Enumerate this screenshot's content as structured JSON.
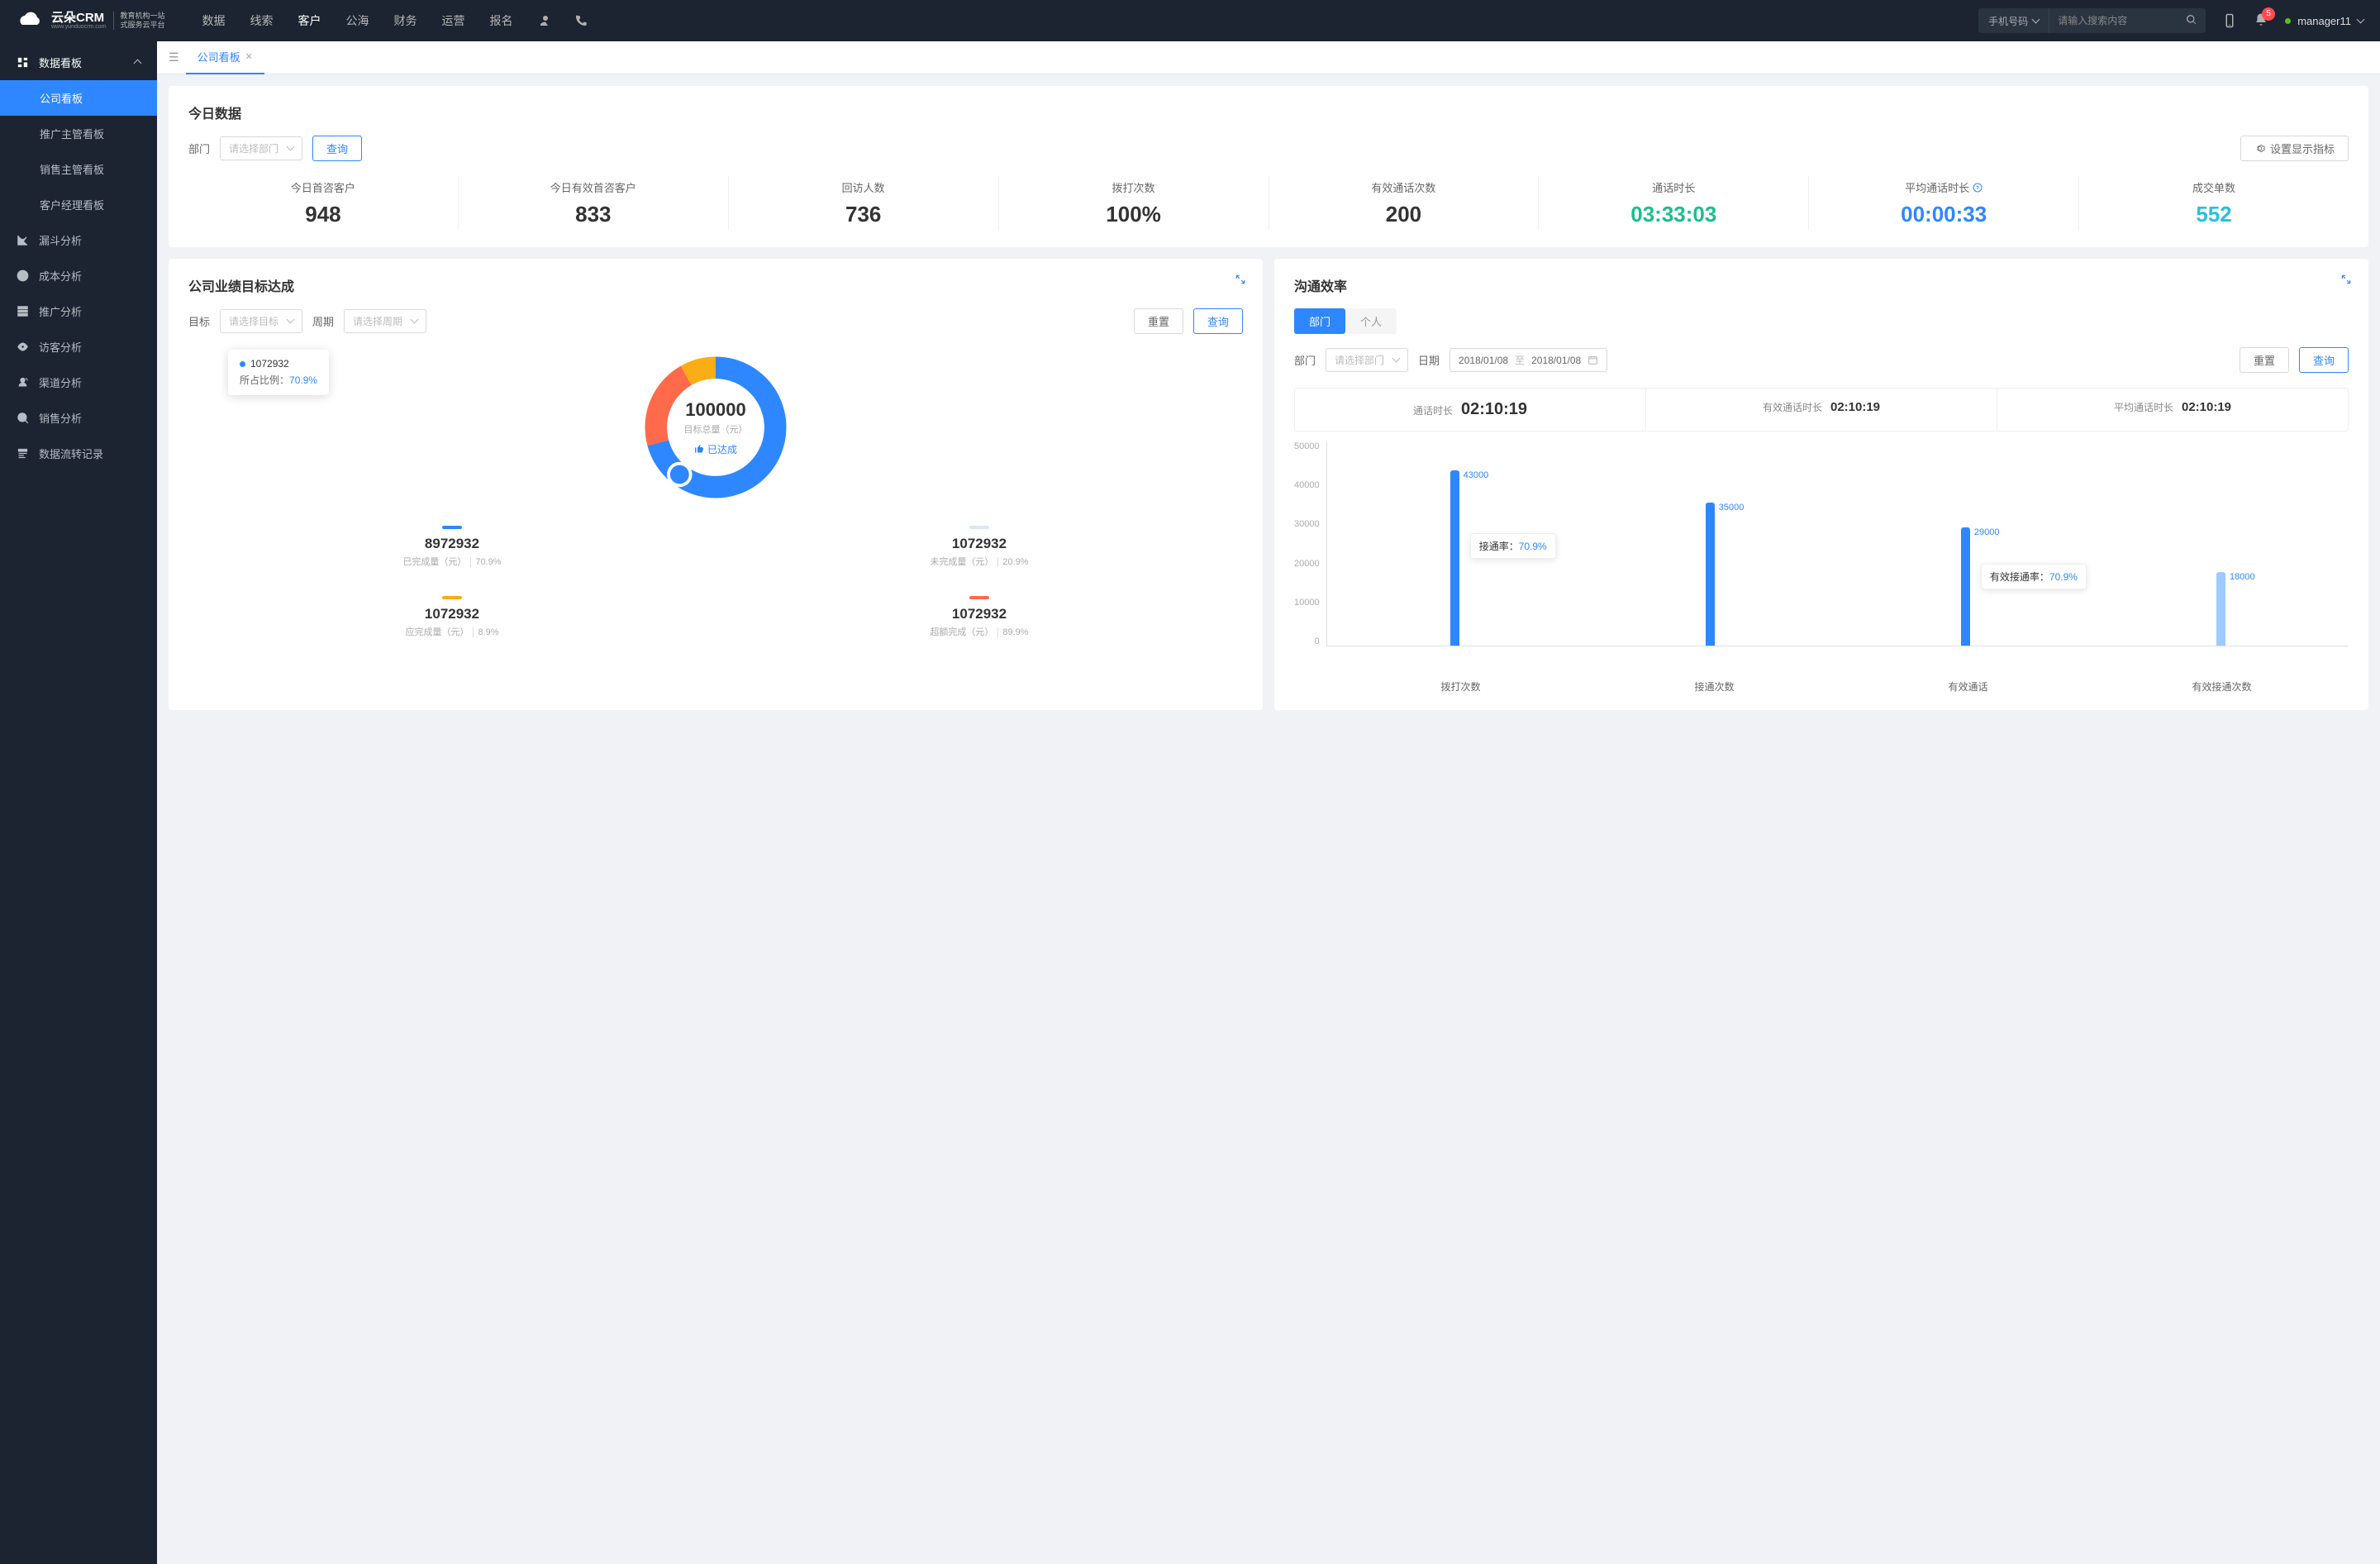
{
  "header": {
    "logo_text": "云朵CRM",
    "logo_sub1": "教育机构一站",
    "logo_sub2": "式服务云平台",
    "logo_url": "www.yunduocrm.com",
    "nav": [
      "数据",
      "线索",
      "客户",
      "公海",
      "财务",
      "运营",
      "报名"
    ],
    "nav_active_index": 2,
    "search_category": "手机号码",
    "search_placeholder": "请输入搜索内容",
    "badge_count": "5",
    "user_name": "manager11"
  },
  "sidebar": {
    "parent": "数据看板",
    "sub": [
      "公司看板",
      "推广主管看板",
      "销售主管看板",
      "客户经理看板"
    ],
    "sub_active_index": 0,
    "items": [
      "漏斗分析",
      "成本分析",
      "推广分析",
      "访客分析",
      "渠道分析",
      "销售分析",
      "数据流转记录"
    ]
  },
  "tab": {
    "label": "公司看板"
  },
  "today": {
    "title": "今日数据",
    "dept_label": "部门",
    "dept_placeholder": "请选择部门",
    "query_btn": "查询",
    "settings_btn": "设置显示指标",
    "metrics": [
      {
        "label": "今日首咨客户",
        "value": "948",
        "cls": ""
      },
      {
        "label": "今日有效首咨客户",
        "value": "833",
        "cls": ""
      },
      {
        "label": "回访人数",
        "value": "736",
        "cls": ""
      },
      {
        "label": "拨打次数",
        "value": "100%",
        "cls": ""
      },
      {
        "label": "有效通话次数",
        "value": "200",
        "cls": ""
      },
      {
        "label": "通话时长",
        "value": "03:33:03",
        "cls": "green"
      },
      {
        "label": "平均通话时长",
        "value": "00:00:33",
        "cls": "blue",
        "help": true
      },
      {
        "label": "成交单数",
        "value": "552",
        "cls": "cyan"
      }
    ]
  },
  "goal": {
    "title": "公司业绩目标达成",
    "target_label": "目标",
    "target_placeholder": "请选择目标",
    "period_label": "周期",
    "period_placeholder": "请选择周期",
    "reset_btn": "重置",
    "query_btn": "查询",
    "center_value": "100000",
    "center_label": "目标总量（元）",
    "status": "已达成",
    "tooltip_value": "1072932",
    "tooltip_ratio_label": "所占比例：",
    "tooltip_ratio": "70.9%",
    "legend": [
      {
        "color": "#2e87ff",
        "value": "8972932",
        "label": "已完成量（元）",
        "pct": "70.9%"
      },
      {
        "color": "#d7e7fa",
        "value": "1072932",
        "label": "未完成量（元）",
        "pct": "20.9%"
      },
      {
        "color": "#faad14",
        "value": "1072932",
        "label": "应完成量（元）",
        "pct": "8.9%"
      },
      {
        "color": "#ff6b4a",
        "value": "1072932",
        "label": "超额完成（元）",
        "pct": "89.9%"
      }
    ]
  },
  "comm": {
    "title": "沟通效率",
    "tab_dept": "部门",
    "tab_personal": "个人",
    "dept_label": "部门",
    "dept_placeholder": "请选择部门",
    "date_label": "日期",
    "date_from": "2018/01/08",
    "date_to": "2018/01/08",
    "date_sep": "至",
    "reset_btn": "重置",
    "query_btn": "查询",
    "stats": [
      {
        "label": "通话时长",
        "value": "02:10:19",
        "big": true
      },
      {
        "label": "有效通话时长",
        "value": "02:10:19"
      },
      {
        "label": "平均通话时长",
        "value": "02:10:19"
      }
    ],
    "tip1_label": "接通率：",
    "tip1_value": "70.9%",
    "tip2_label": "有效接通率：",
    "tip2_value": "70.9%"
  },
  "chart_data": {
    "type": "bar",
    "categories": [
      "拨打次数",
      "接通次数",
      "有效通话",
      "有效接通次数"
    ],
    "values": [
      43000,
      35000,
      29000,
      18000
    ],
    "colors": [
      "#2e87ff",
      "#2e87ff",
      "#2e87ff",
      "#9fcaff"
    ],
    "ylim": [
      0,
      50000
    ],
    "yticks": [
      0,
      10000,
      20000,
      30000,
      40000,
      50000
    ],
    "ylabel": "",
    "xlabel": "",
    "title": ""
  }
}
